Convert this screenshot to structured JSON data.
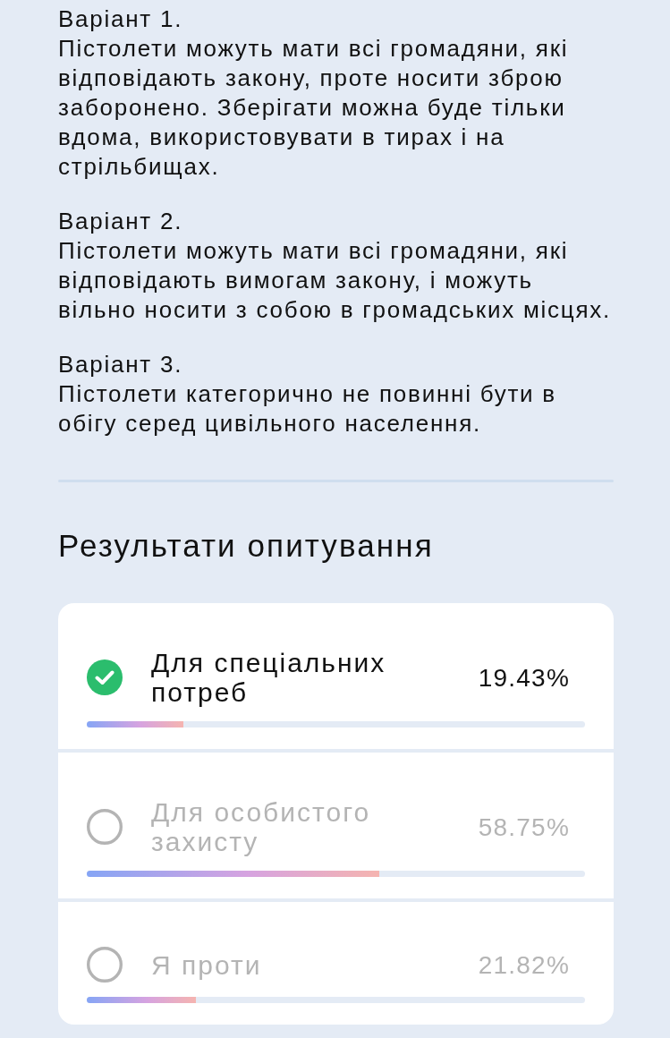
{
  "variants": [
    {
      "title": "Варіант 1.",
      "text": "Пістолети можуть мати всі громадяни, які відповідають закону, проте носити зброю заборонено. Зберігати можна буде тільки вдома, використовувати в тирах і на стрільбищах."
    },
    {
      "title": "Варіант 2.",
      "text": "Пістолети можуть мати всі громадяни, які відповідають вимогам закону, і можуть вільно носити з собою в громадських місцях."
    },
    {
      "title": "Варіант 3.",
      "text": "Пістолети категорично не повинні бути в обігу серед цивільного населення."
    }
  ],
  "results": {
    "heading": "Результати опитування",
    "options": [
      {
        "label": "Для спеціальних потреб",
        "percent": "19.43%",
        "level": 0.1943,
        "selected": true
      },
      {
        "label": "Для особистого захисту",
        "percent": "58.75%",
        "level": 0.5875,
        "selected": false
      },
      {
        "label": "Я проти",
        "percent": "21.82%",
        "level": 0.2182,
        "selected": false
      }
    ]
  }
}
